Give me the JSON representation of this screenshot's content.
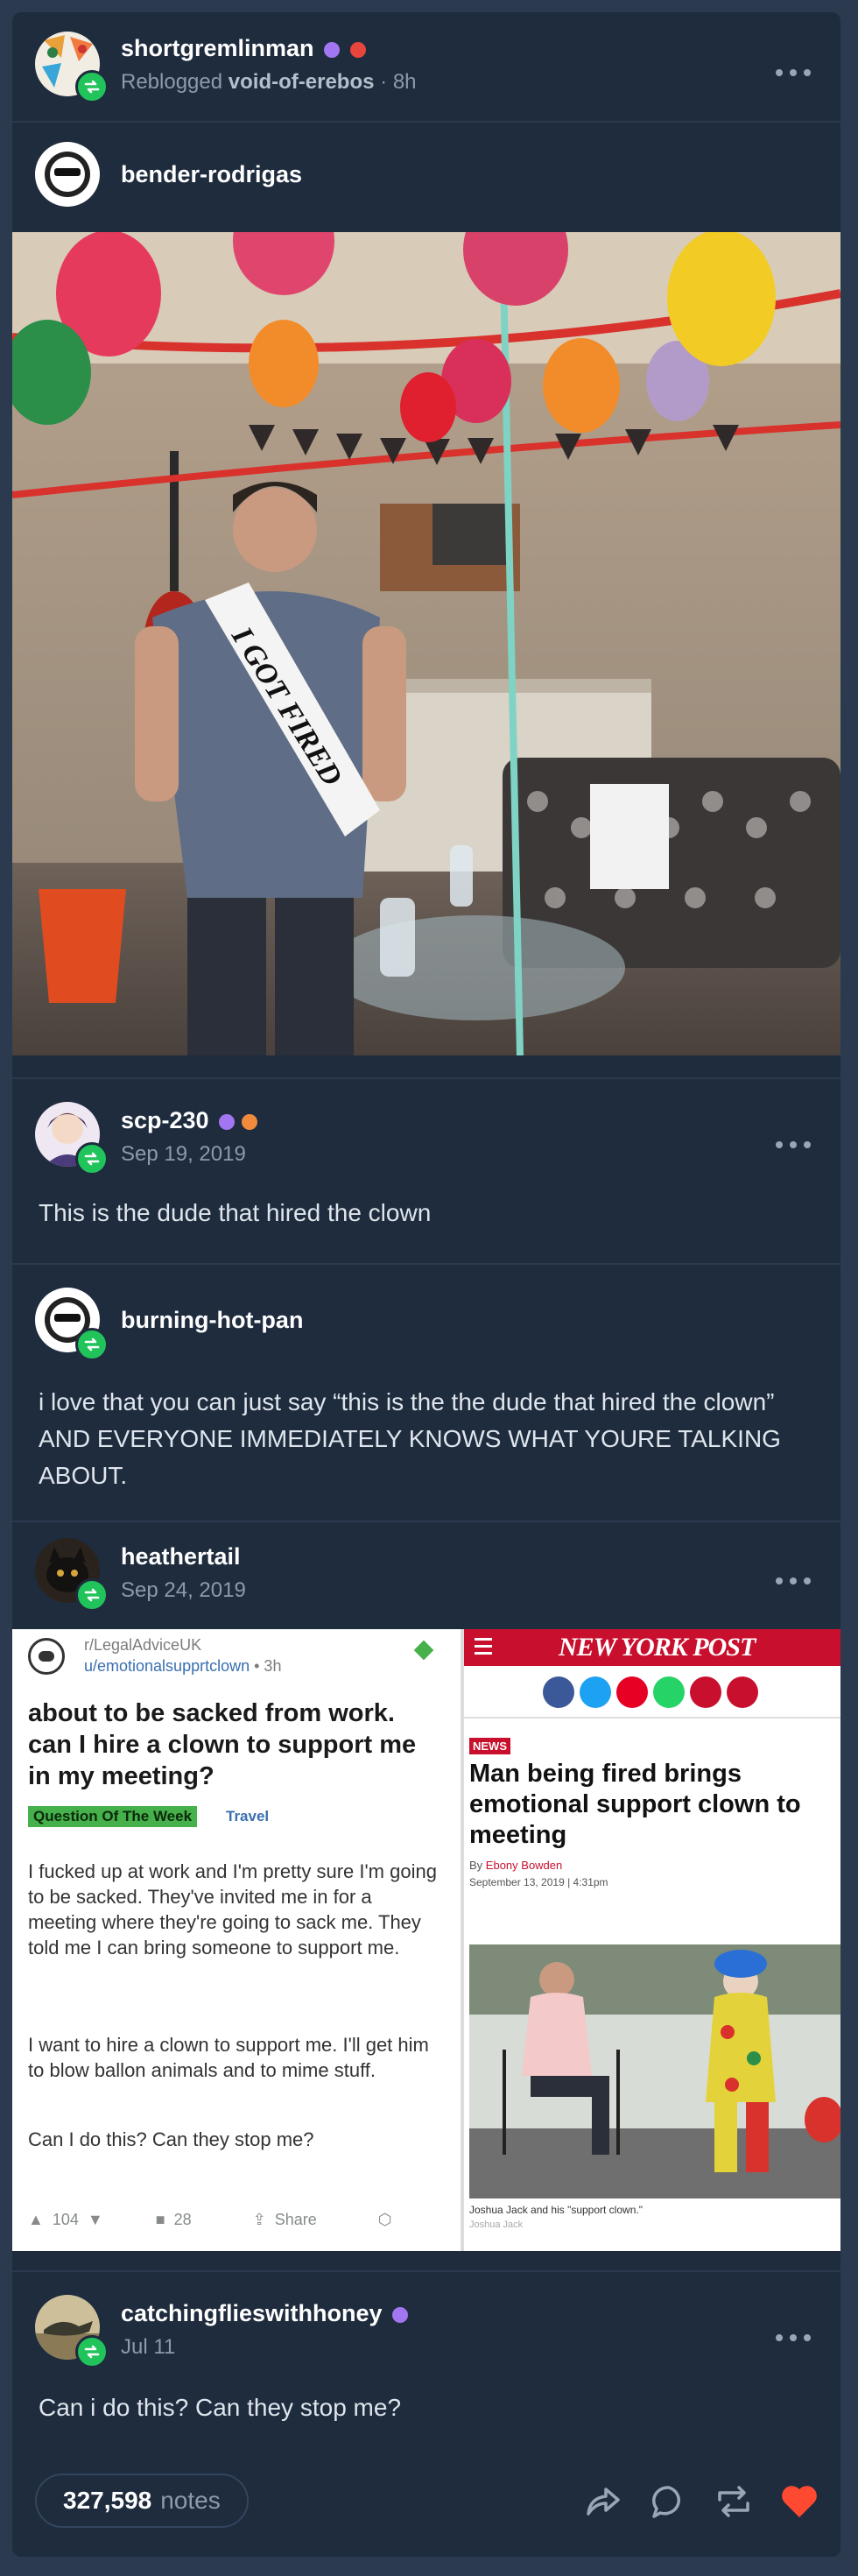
{
  "post": {
    "reblogger": {
      "name": "shortgremlinman",
      "reblogged_label": "Reblogged",
      "reblogged_from": "void-of-erebos",
      "time": "8h"
    },
    "original": {
      "name": "bender-rodrigas"
    },
    "photo": {
      "sash_text": "I GOT FIRED"
    },
    "trail": [
      {
        "name": "scp-230",
        "date": "Sep 19, 2019",
        "text": "This is the dude that hired the clown"
      },
      {
        "name": "burning-hot-pan",
        "text": "i love that you can just say “this is the the dude that hired the clown” AND EVERYONE IMMEDIATELY KNOWS WHAT YOURE TALKING ABOUT."
      },
      {
        "name": "heathertail",
        "date": "Sep 24, 2019"
      },
      {
        "name": "catchingflieswithhoney",
        "date": "Jul 11",
        "text": "Can i do this? Can they stop me?"
      }
    ],
    "reddit": {
      "subreddit": "r/LegalAdviceUK",
      "user": "u/emotionalsupprtclown",
      "age": "• 3h",
      "title": "about to be sacked from work. can I hire a clown to support me in my meeting?",
      "flair": "Question Of The Week",
      "tag": "Travel",
      "para1": "I fucked up at work and I'm pretty sure I'm going to be sacked. They've invited me in for a meeting where they're going to sack me. They told me I can bring someone to support me.",
      "para2": "I want to hire a clown to support me. I'll get him to blow ballon animals and to mime stuff.",
      "para3": "Can I do this? Can they stop me?",
      "upvotes": "104",
      "comments": "28",
      "share": "Share"
    },
    "nypost": {
      "masthead": "NEW YORK POST",
      "section": "NEWS",
      "headline": "Man being fired brings emotional support clown to meeting",
      "byline_prefix": "By",
      "byline_author": "Ebony Bowden",
      "dateline": "September 13, 2019 | 4:31pm",
      "caption": "Joshua Jack and his \"support clown.\"",
      "credit": "Joshua Jack"
    },
    "notes": {
      "count": "327,598",
      "label": "notes"
    }
  },
  "colors": {
    "card": "#1e2c3e",
    "page": "#2b3a4f",
    "reblog_green": "#21c35b",
    "like_red": "#ff4930",
    "nypost_red": "#c8102e"
  }
}
